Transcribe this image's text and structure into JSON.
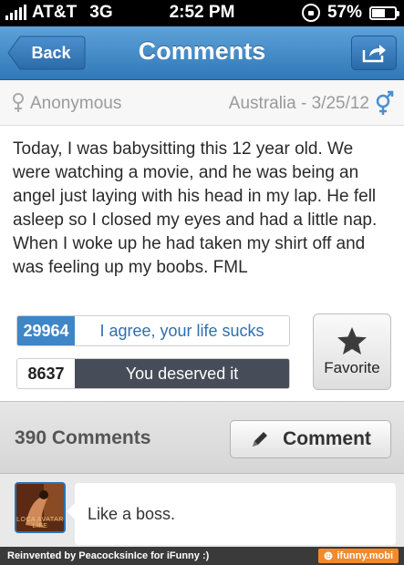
{
  "status_bar": {
    "carrier": "AT&T",
    "network": "3G",
    "time": "2:52 PM",
    "battery": "57%",
    "battery_level": 0.57
  },
  "nav": {
    "back_label": "Back",
    "title": "Comments"
  },
  "post": {
    "author": "Anonymous",
    "location_date": "Australia - 3/25/12",
    "text": "Today, I was babysitting this 12 year old. We were watching a movie, and he was being an angel just laying with his head in my lap. He fell asleep so I closed my eyes and had a little nap. When I woke up he had taken my shirt off and was feeling up my boobs. FML",
    "votes": {
      "agree_count": "29964",
      "agree_label": "I agree, your life sucks",
      "deserved_count": "8637",
      "deserved_label": "You deserved it"
    },
    "favorite_label": "Favorite"
  },
  "comments": {
    "count_label": "390 Comments",
    "comment_button_label": "Comment",
    "items": [
      {
        "avatar_text": "LOCA AVATAR LIFE",
        "text": "Like a boss."
      }
    ]
  },
  "footer": {
    "credit": "Reinvented by PeacocksinIce for iFunny :)",
    "brand": "ifunny.mobi"
  },
  "colors": {
    "nav_blue": "#2f78b8",
    "agree_blue": "#3f86c7",
    "deserved_dark": "#474d58",
    "brand_orange": "#f28a2b"
  },
  "icons": [
    "signal-icon",
    "lock-rotation-icon",
    "battery-icon",
    "share-icon",
    "female-icon",
    "gender-icon",
    "star-icon",
    "pencil-icon",
    "ifunny-logo-icon"
  ]
}
